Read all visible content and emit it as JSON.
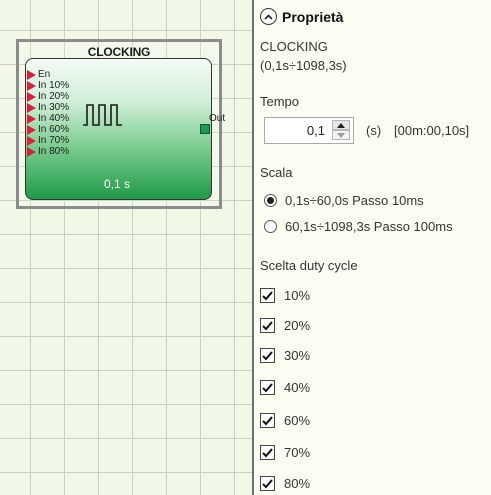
{
  "block": {
    "title": "CLOCKING",
    "inputs": [
      "En",
      "In 10%",
      "In 20%",
      "In 30%",
      "In 40%",
      "In 60%",
      "In 70%",
      "In 80%"
    ],
    "output_label": "Out",
    "value": "0,1 s",
    "colors": {
      "input_arrow": "#e01f36",
      "block_bottom": "#1f9a48",
      "output_pin": "#1a9a52"
    }
  },
  "panel": {
    "title": "Proprietà",
    "collapse_icon": "chevron-up-icon",
    "block_name": "CLOCKING",
    "block_range": "(0,1s÷1098,3s)",
    "time": {
      "label": "Tempo",
      "value": "0,1",
      "unit": "(s)",
      "formatted": "[00m:00,10s]"
    },
    "scale": {
      "label": "Scala",
      "options": [
        {
          "label": "0,1s÷60,0s Passo 10ms",
          "selected": true
        },
        {
          "label": "60,1s÷1098,3s Passo 100ms",
          "selected": false
        }
      ]
    },
    "duty_cycle": {
      "label": "Scelta duty cycle",
      "items": [
        {
          "label": "10%",
          "checked": true
        },
        {
          "label": "20%",
          "checked": true
        },
        {
          "label": "30%",
          "checked": true
        },
        {
          "label": "40%",
          "checked": true
        },
        {
          "label": "60%",
          "checked": true
        },
        {
          "label": "70%",
          "checked": true
        },
        {
          "label": "80%",
          "checked": true
        }
      ]
    }
  }
}
